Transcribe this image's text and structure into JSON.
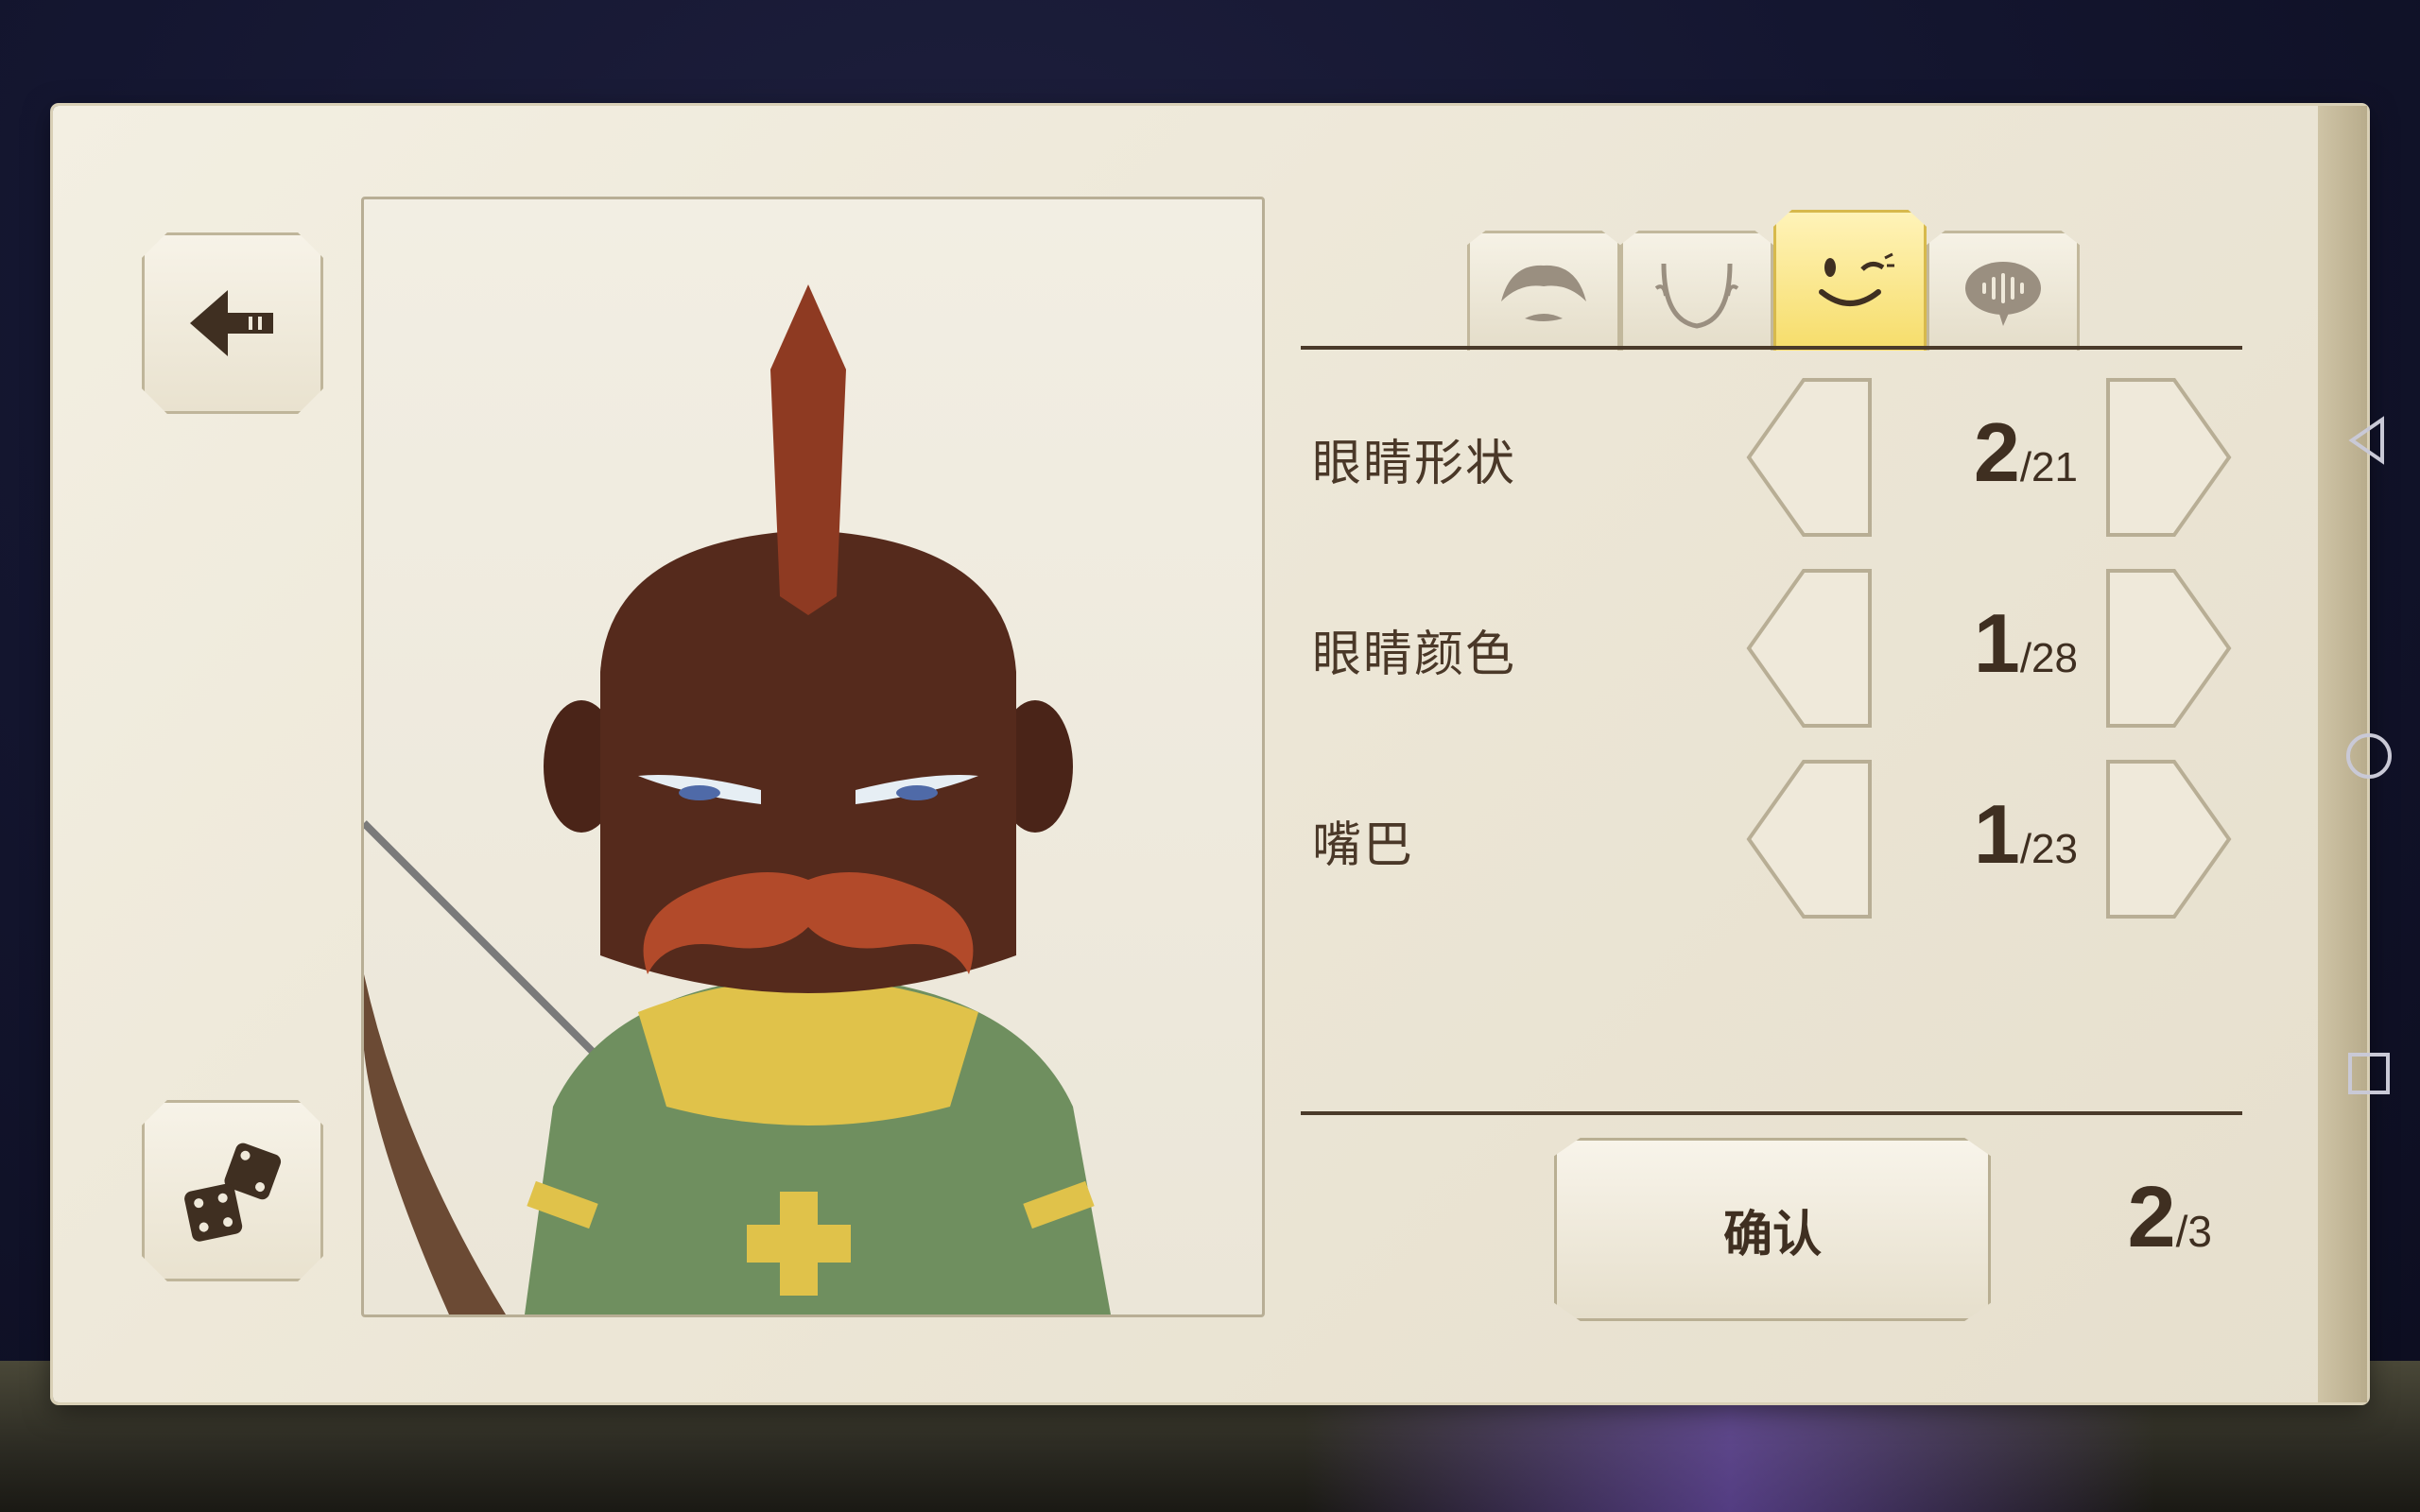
{
  "tabs": [
    {
      "name": "hair-tab",
      "icon": "hair-icon",
      "active": false
    },
    {
      "name": "face-shape-tab",
      "icon": "face-shape-icon",
      "active": false
    },
    {
      "name": "expression-tab",
      "icon": "wink-face-icon",
      "active": true
    },
    {
      "name": "voice-tab",
      "icon": "voice-bubble-icon",
      "active": false
    }
  ],
  "rows": [
    {
      "label": "眼睛形状",
      "current": "2",
      "total": "/21"
    },
    {
      "label": "眼睛颜色",
      "current": "1",
      "total": "/28"
    },
    {
      "label": "嘴巴",
      "current": "1",
      "total": "/23"
    }
  ],
  "confirm_label": "确认",
  "page": {
    "current": "2",
    "total": "/3"
  },
  "colors": {
    "panel": "#ece6d6",
    "active_tab": "#f6dd6a",
    "text": "#4a3828",
    "line": "#4a3a2a"
  }
}
